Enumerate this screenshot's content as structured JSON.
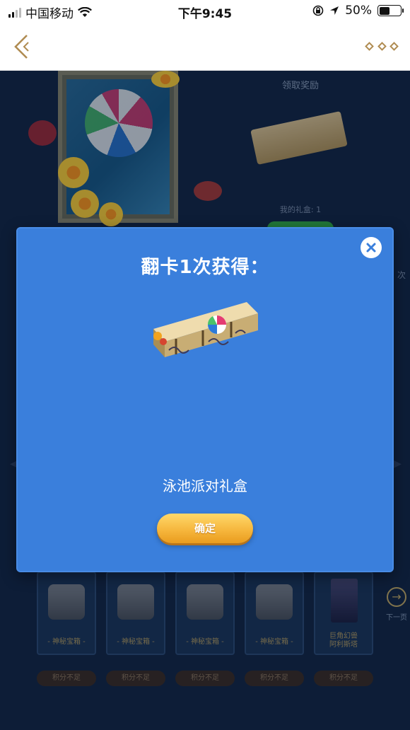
{
  "status_bar": {
    "carrier": "中国移动",
    "time": "下午9:45",
    "battery_percent": "50%"
  },
  "background": {
    "reward_title": "领取奖励",
    "my_giftbox": "我的礼盒: 1",
    "side_char": "次",
    "cards": [
      {
        "title": "- 神秘宝箱 -",
        "points": "积分不足"
      },
      {
        "title": "- 神秘宝箱 -",
        "points": "积分不足"
      },
      {
        "title": "- 神秘宝箱 -",
        "points": "积分不足"
      },
      {
        "title": "- 神秘宝箱 -",
        "points": "积分不足"
      },
      {
        "title_line1": "巨角幻兽",
        "title_line2": "阿利斯塔",
        "points": "积分不足"
      }
    ],
    "next_page": "下一页"
  },
  "modal": {
    "title": "翻卡1次获得：",
    "item_name": "泳池派对礼盒",
    "confirm_label": "确定"
  },
  "colors": {
    "modal_bg": "#3a7fdc",
    "accent_gold": "#f5b43a",
    "page_bg": "#122847"
  },
  "icons": [
    "signal-icon",
    "wifi-icon",
    "lock-rotation-icon",
    "location-icon",
    "battery-icon",
    "back-arrow-icon",
    "more-dots-icon",
    "close-icon",
    "next-arrow-icon"
  ]
}
